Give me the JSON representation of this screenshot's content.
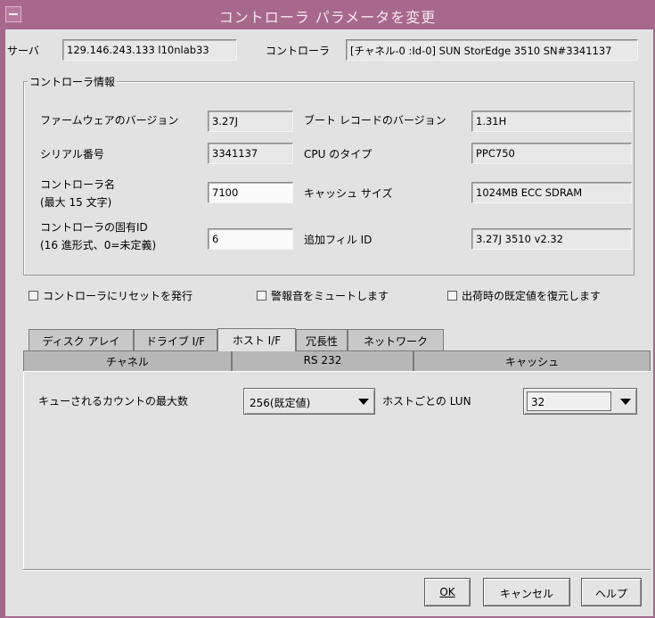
{
  "window": {
    "title": "コントローラ パラメータを変更"
  },
  "server": {
    "label": "サーバ",
    "value": "129.146.243.133 l10nlab33"
  },
  "controller": {
    "label": "コントローラ",
    "value": "[チャネル-0 :Id-0] SUN StorEdge 3510 SN#3341137"
  },
  "info": {
    "legend": "コントローラ情報",
    "firmware_label": "ファームウェアのバージョン",
    "firmware_value": "3.27J",
    "boot_label": "ブート レコードのバージョン",
    "boot_value": "1.31H",
    "serial_label": "シリアル番号",
    "serial_value": "3341137",
    "cpu_label": "CPU のタイプ",
    "cpu_value": "PPC750",
    "name_label_1": "コントローラ名",
    "name_label_2": "(最大 15 文字)",
    "name_value": "7100",
    "cache_label": "キャッシュ サイズ",
    "cache_value": "1024MB ECC SDRAM",
    "uid_label_1": "コントローラの固有ID",
    "uid_label_2": "(16 進形式、0=未定義)",
    "uid_value": "6",
    "fru_label": "追加フィル ID",
    "fru_value": "3.27J 3510 v2.32"
  },
  "checkboxes": {
    "reset": "コントローラにリセットを発行",
    "mute": "警報音をミュートします",
    "restore": "出荷時の既定値を復元します"
  },
  "tabs": [
    "ディスク アレイ",
    "ドライブ I/F",
    "ホスト I/F",
    "冗長性",
    "ネットワーク"
  ],
  "subtabs": [
    "チャネル",
    "RS 232",
    "キャッシュ"
  ],
  "host": {
    "queue_label": "キューされるカウントの最大数",
    "queue_value": "256(既定値)",
    "lun_label": "ホストごとの LUN",
    "lun_value": "32"
  },
  "buttons": {
    "ok": "OK",
    "cancel": "キャンセル",
    "help": "ヘルプ"
  }
}
